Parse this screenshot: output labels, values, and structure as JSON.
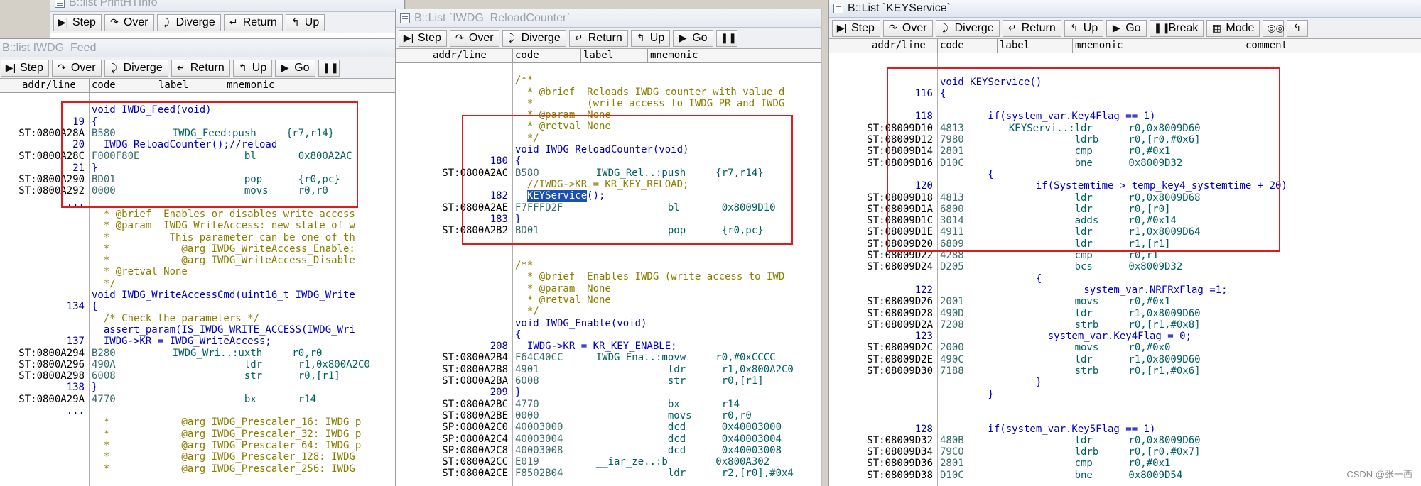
{
  "windows": {
    "bg": {
      "title": "B::list PrintHTInfo"
    },
    "feed": {
      "title": "B::list IWDG_Feed"
    },
    "reload": {
      "title": "B::List `IWDG_ReloadCounter`"
    },
    "keyservice": {
      "title": "B::List `KEYService`"
    }
  },
  "toolbar": {
    "step": "Step",
    "over": "Over",
    "diverge": "Diverge",
    "return": "Return",
    "up": "Up",
    "go": "Go",
    "break": "Break",
    "mode": "Mode"
  },
  "columns": {
    "addr": "addr/line",
    "code": "code",
    "label": "label",
    "mnemonic": "mnemonic",
    "comment": "comment"
  },
  "icons": [
    "list-window-icon",
    "step-icon",
    "over-icon",
    "diverge-icon",
    "return-icon",
    "up-icon",
    "go-icon",
    "break-icon",
    "mode-icon",
    "glasses-icon",
    "stepback-icon"
  ],
  "colors": {
    "redbox": "#e01b1b",
    "selection": "#1a4fb5",
    "source": "#0000c0",
    "comment": "#8b7d00",
    "asm": "#005f5f"
  },
  "feed_lines": [
    {
      "ln": "",
      "addr": "",
      "hex": "",
      "src": ""
    },
    {
      "ln": "",
      "addr": "",
      "hex": "",
      "src": "void IWDG_Feed(void)"
    },
    {
      "ln": "19",
      "addr": "",
      "hex": "",
      "src": "{"
    },
    {
      "ln": "",
      "addr": "ST:0800A28A",
      "hex": "B580",
      "asm": "    IWDG_Feed:push     {r7,r14}"
    },
    {
      "ln": "20",
      "addr": "",
      "hex": "",
      "src": "  IWDG_ReloadCounter();//reload"
    },
    {
      "ln": "",
      "addr": "ST:0800A28C",
      "hex": "F000F80E",
      "asm": "                bl       0x800A2AC"
    },
    {
      "ln": "21",
      "addr": "",
      "hex": "",
      "src": "}"
    },
    {
      "ln": "",
      "addr": "ST:0800A290",
      "hex": "BD01",
      "asm": "                pop      {r0,pc}"
    },
    {
      "ln": "",
      "addr": "ST:0800A292",
      "hex": "0000",
      "asm": "                movs     r0,r0"
    },
    {
      "ln": "...",
      "addr": "",
      "hex": "",
      "src": ""
    },
    {
      "ln": "",
      "addr": "",
      "hex": "",
      "cmt": "  * @brief  Enables or disables write access"
    },
    {
      "ln": "",
      "addr": "",
      "hex": "",
      "cmt": "  * @param  IWDG_WriteAccess: new state of w"
    },
    {
      "ln": "",
      "addr": "",
      "hex": "",
      "cmt": "  *          This parameter can be one of th"
    },
    {
      "ln": "",
      "addr": "",
      "hex": "",
      "cmt": "  *            @arg IWDG_WriteAccess_Enable:"
    },
    {
      "ln": "",
      "addr": "",
      "hex": "",
      "cmt": "  *            @arg IWDG_WriteAccess_Disable"
    },
    {
      "ln": "",
      "addr": "",
      "hex": "",
      "cmt": "  * @retval None"
    },
    {
      "ln": "",
      "addr": "",
      "hex": "",
      "cmt": "  */"
    },
    {
      "ln": "",
      "addr": "",
      "hex": "",
      "src": "void IWDG_WriteAccessCmd(uint16_t IWDG_Write"
    },
    {
      "ln": "134",
      "addr": "",
      "hex": "",
      "src": "{"
    },
    {
      "ln": "",
      "addr": "",
      "hex": "",
      "cmt": "  /* Check the parameters */"
    },
    {
      "ln": "",
      "addr": "",
      "hex": "",
      "src": "  assert_param(IS_IWDG_WRITE_ACCESS(IWDG_Wri"
    },
    {
      "ln": "137",
      "addr": "",
      "hex": "",
      "src": "  IWDG->KR = IWDG_WriteAccess;"
    },
    {
      "ln": "",
      "addr": "ST:0800A294",
      "hex": "B280",
      "asm": "    IWDG_Wri..:uxth     r0,r0"
    },
    {
      "ln": "",
      "addr": "ST:0800A296",
      "hex": "490A",
      "asm": "                ldr      r1,0x800A2C0"
    },
    {
      "ln": "",
      "addr": "ST:0800A298",
      "hex": "6008",
      "asm": "                str      r0,[r1]"
    },
    {
      "ln": "138",
      "addr": "",
      "hex": "",
      "src": "}"
    },
    {
      "ln": "",
      "addr": "ST:0800A29A",
      "hex": "4770",
      "asm": "                bx       r14"
    },
    {
      "ln": "...",
      "addr": "",
      "hex": "",
      "src": ""
    },
    {
      "ln": "",
      "addr": "",
      "hex": "",
      "cmt": "  *            @arg IWDG_Prescaler_16: IWDG p"
    },
    {
      "ln": "",
      "addr": "",
      "hex": "",
      "cmt": "  *            @arg IWDG_Prescaler_32: IWDG p"
    },
    {
      "ln": "",
      "addr": "",
      "hex": "",
      "cmt": "  *            @arg IWDG_Prescaler_64: IWDG p"
    },
    {
      "ln": "",
      "addr": "",
      "hex": "",
      "cmt": "  *            @arg IWDG_Prescaler_128: IWDG"
    },
    {
      "ln": "",
      "addr": "",
      "hex": "",
      "cmt": "  *            @arg IWDG_Prescaler_256: IWDG"
    }
  ],
  "reload_lines": [
    {
      "ln": "",
      "addr": "",
      "hex": "",
      "src": ""
    },
    {
      "ln": "",
      "addr": "",
      "hex": "",
      "cmt": "/**"
    },
    {
      "ln": "",
      "addr": "",
      "hex": "",
      "cmt": "  * @brief  Reloads IWDG counter with value d"
    },
    {
      "ln": "",
      "addr": "",
      "hex": "",
      "cmt": "  *         (write access to IWDG_PR and IWDG"
    },
    {
      "ln": "",
      "addr": "",
      "hex": "",
      "cmt": "  * @param  None"
    },
    {
      "ln": "",
      "addr": "",
      "hex": "",
      "cmt": "  * @retval None"
    },
    {
      "ln": "",
      "addr": "",
      "hex": "",
      "cmt": "  */"
    },
    {
      "ln": "",
      "addr": "",
      "hex": "",
      "src": "void IWDG_ReloadCounter(void)"
    },
    {
      "ln": "180",
      "addr": "",
      "hex": "",
      "src": "{"
    },
    {
      "ln": "",
      "addr": "ST:0800A2AC",
      "hex": "B580",
      "asm": "    IWDG_Rel..:push     {r7,r14}"
    },
    {
      "ln": "",
      "addr": "",
      "hex": "",
      "cmt": "  //IWDG->KR = KR_KEY_RELOAD;"
    },
    {
      "ln": "182",
      "addr": "",
      "hex": "",
      "src": "  ",
      "hlsrc": "KEYService",
      "tail": "();"
    },
    {
      "ln": "",
      "addr": "ST:0800A2AE",
      "hex": "F7FFFD2F",
      "asm": "                bl       0x8009D10"
    },
    {
      "ln": "183",
      "addr": "",
      "hex": "",
      "src": "}"
    },
    {
      "ln": "",
      "addr": "ST:0800A2B2",
      "hex": "BD01",
      "asm": "                pop      {r0,pc}"
    },
    {
      "ln": "",
      "addr": "",
      "hex": "",
      "src": ""
    },
    {
      "ln": "",
      "addr": "",
      "hex": "",
      "src": ""
    },
    {
      "ln": "",
      "addr": "",
      "hex": "",
      "cmt": "/**"
    },
    {
      "ln": "",
      "addr": "",
      "hex": "",
      "cmt": "  * @brief  Enables IWDG (write access to IWD"
    },
    {
      "ln": "",
      "addr": "",
      "hex": "",
      "cmt": "  * @param  None"
    },
    {
      "ln": "",
      "addr": "",
      "hex": "",
      "cmt": "  * @retval None"
    },
    {
      "ln": "",
      "addr": "",
      "hex": "",
      "cmt": "  */"
    },
    {
      "ln": "",
      "addr": "",
      "hex": "",
      "src": "void IWDG_Enable(void)"
    },
    {
      "ln": "",
      "addr": "",
      "hex": "",
      "src": "{"
    },
    {
      "ln": "208",
      "addr": "",
      "hex": "",
      "src": "  IWDG->KR = KR_KEY_ENABLE;"
    },
    {
      "ln": "",
      "addr": "ST:0800A2B4",
      "hex": "F64C40CC",
      "asm": "    IWDG_Ena..:movw     r0,#0xCCCC"
    },
    {
      "ln": "",
      "addr": "ST:0800A2B8",
      "hex": "4901",
      "asm": "                ldr      r1,0x800A2C0"
    },
    {
      "ln": "",
      "addr": "ST:0800A2BA",
      "hex": "6008",
      "asm": "                str      r0,[r1]"
    },
    {
      "ln": "209",
      "addr": "",
      "hex": "",
      "src": "}"
    },
    {
      "ln": "",
      "addr": "ST:0800A2BC",
      "hex": "4770",
      "asm": "                bx       r14"
    },
    {
      "ln": "",
      "addr": "ST:0800A2BE",
      "hex": "0000",
      "asm": "                movs     r0,r0"
    },
    {
      "ln": "",
      "addr": "SP:0800A2C0",
      "hex": "40003000",
      "asm": "                dcd      0x40003000"
    },
    {
      "ln": "",
      "addr": "SP:0800A2C4",
      "hex": "40003004",
      "asm": "                dcd      0x40003004"
    },
    {
      "ln": "",
      "addr": "SP:0800A2C8",
      "hex": "40003008",
      "asm": "                dcd      0x40003008"
    },
    {
      "ln": "",
      "addr": "ST:0800A2CC",
      "hex": "E019",
      "asm": "    __iar_ze..:b        0x800A302"
    },
    {
      "ln": "",
      "addr": "ST:0800A2CE",
      "hex": "F8502B04",
      "asm": "                ldr      r2,[r0],#0x4"
    }
  ],
  "key_lines": [
    {
      "ln": "",
      "addr": "",
      "hex": "",
      "src": ""
    },
    {
      "ln": "",
      "addr": "",
      "hex": "",
      "src": ""
    },
    {
      "ln": "",
      "addr": "",
      "hex": "",
      "src": "void KEYService()"
    },
    {
      "ln": "116",
      "addr": "",
      "hex": "",
      "src": "{"
    },
    {
      "ln": "",
      "addr": "",
      "hex": "",
      "src": ""
    },
    {
      "ln": "118",
      "addr": "",
      "hex": "",
      "src": "        if(system_var.Key4Flag == 1)"
    },
    {
      "ln": "",
      "addr": "ST:08009D10",
      "hex": "4813",
      "asm": "  KEYServi..:ldr      r0,0x8009D60"
    },
    {
      "ln": "",
      "addr": "ST:08009D12",
      "hex": "7980",
      "asm": "             ldrb     r0,[r0,#0x6]"
    },
    {
      "ln": "",
      "addr": "ST:08009D14",
      "hex": "2801",
      "asm": "             cmp      r0,#0x1"
    },
    {
      "ln": "",
      "addr": "ST:08009D16",
      "hex": "D10C",
      "asm": "             bne      0x8009D32"
    },
    {
      "ln": "",
      "addr": "",
      "hex": "",
      "src": "        {"
    },
    {
      "ln": "120",
      "addr": "",
      "hex": "",
      "src": "                if(Systemtime > temp_key4_systemtime + 20)"
    },
    {
      "ln": "",
      "addr": "ST:08009D18",
      "hex": "4813",
      "asm": "             ldr      r0,0x8009D68"
    },
    {
      "ln": "",
      "addr": "ST:08009D1A",
      "hex": "6800",
      "asm": "             ldr      r0,[r0]"
    },
    {
      "ln": "",
      "addr": "ST:08009D1C",
      "hex": "3014",
      "asm": "             adds     r0,#0x14"
    },
    {
      "ln": "",
      "addr": "ST:08009D1E",
      "hex": "4911",
      "asm": "             ldr      r1,0x8009D64"
    },
    {
      "ln": "",
      "addr": "ST:08009D20",
      "hex": "6809",
      "asm": "             ldr      r1,[r1]"
    },
    {
      "ln": "",
      "addr": "ST:08009D22",
      "hex": "4288",
      "asm": "             cmp      r0,r1"
    },
    {
      "ln": "",
      "addr": "ST:08009D24",
      "hex": "D205",
      "asm": "             bcs      0x8009D32"
    },
    {
      "ln": "",
      "addr": "",
      "hex": "",
      "src": "                {"
    },
    {
      "ln": "122",
      "addr": "",
      "hex": "",
      "src": "                        system_var.NRFRxFlag =1;"
    },
    {
      "ln": "",
      "addr": "ST:08009D26",
      "hex": "2001",
      "asm": "             movs     r0,#0x1"
    },
    {
      "ln": "",
      "addr": "ST:08009D28",
      "hex": "490D",
      "asm": "             ldr      r1,0x8009D60"
    },
    {
      "ln": "",
      "addr": "ST:08009D2A",
      "hex": "7208",
      "asm": "             strb     r0,[r1,#0x8]"
    },
    {
      "ln": "123",
      "addr": "",
      "hex": "",
      "src": "                  system_var.Key4Flag = 0;"
    },
    {
      "ln": "",
      "addr": "ST:08009D2C",
      "hex": "2000",
      "asm": "             movs     r0,#0x0"
    },
    {
      "ln": "",
      "addr": "ST:08009D2E",
      "hex": "490C",
      "asm": "             ldr      r1,0x8009D60"
    },
    {
      "ln": "",
      "addr": "ST:08009D30",
      "hex": "7188",
      "asm": "             strb     r0,[r1,#0x6]"
    },
    {
      "ln": "",
      "addr": "",
      "hex": "",
      "src": "                }"
    },
    {
      "ln": "",
      "addr": "",
      "hex": "",
      "src": "        }"
    },
    {
      "ln": "",
      "addr": "",
      "hex": "",
      "src": ""
    },
    {
      "ln": "",
      "addr": "",
      "hex": "",
      "src": ""
    },
    {
      "ln": "128",
      "addr": "",
      "hex": "",
      "src": "        if(system_var.Key5Flag == 1)"
    },
    {
      "ln": "",
      "addr": "ST:08009D32",
      "hex": "480B",
      "asm": "             ldr      r0,0x8009D60"
    },
    {
      "ln": "",
      "addr": "ST:08009D34",
      "hex": "79C0",
      "asm": "             ldrb     r0,[r0,#0x7]"
    },
    {
      "ln": "",
      "addr": "ST:08009D36",
      "hex": "2801",
      "asm": "             cmp      r0,#0x1"
    },
    {
      "ln": "",
      "addr": "ST:08009D38",
      "hex": "D10C",
      "asm": "             bne      0x8009D54"
    }
  ],
  "watermark": "CSDN @张一西"
}
